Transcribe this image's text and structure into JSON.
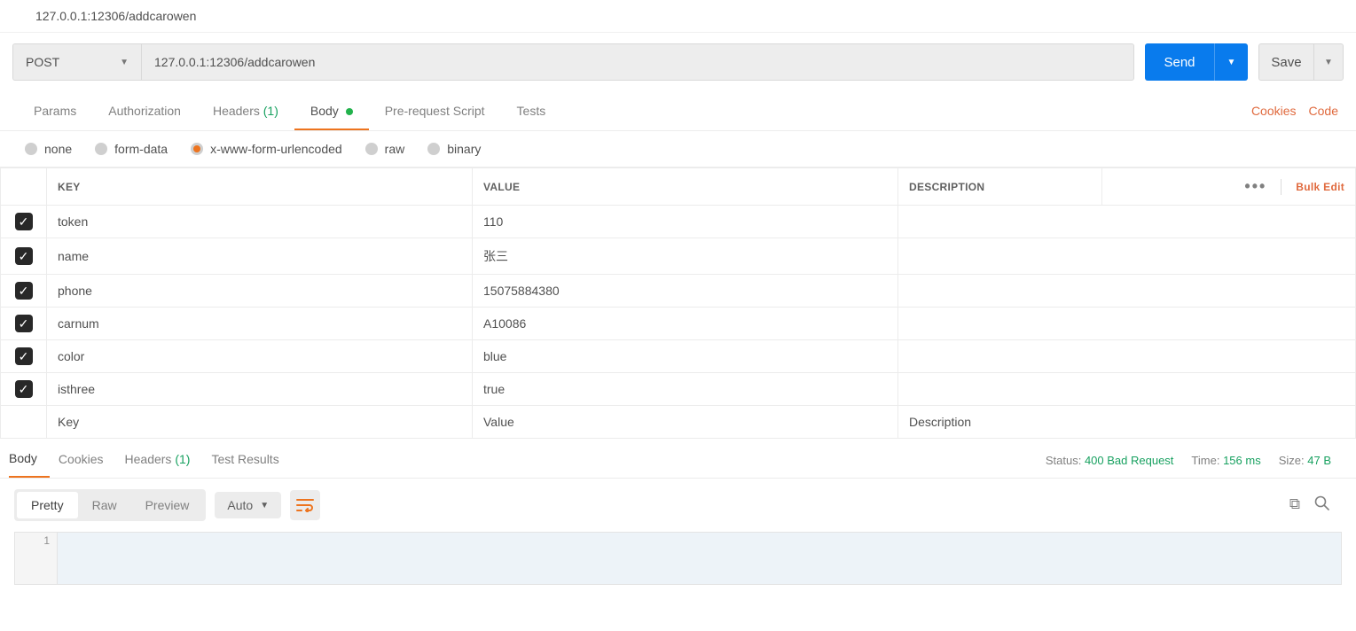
{
  "title": "127.0.0.1:12306/addcarowen",
  "request": {
    "method": "POST",
    "url": "127.0.0.1:12306/addcarowen",
    "send_label": "Send",
    "save_label": "Save"
  },
  "req_tabs": {
    "params": "Params",
    "authorization": "Authorization",
    "headers": "Headers",
    "headers_count": "(1)",
    "body": "Body",
    "prerequest": "Pre-request Script",
    "tests": "Tests",
    "cookies_link": "Cookies",
    "code_link": "Code"
  },
  "body_types": {
    "none": "none",
    "formdata": "form-data",
    "urlencoded": "x-www-form-urlencoded",
    "raw": "raw",
    "binary": "binary"
  },
  "table": {
    "header_key": "KEY",
    "header_value": "VALUE",
    "header_desc": "DESCRIPTION",
    "bulk_edit": "Bulk Edit",
    "key_placeholder": "Key",
    "value_placeholder": "Value",
    "desc_placeholder": "Description",
    "rows": [
      {
        "key": "token",
        "value": "110",
        "desc": ""
      },
      {
        "key": "name",
        "value": "张三",
        "desc": ""
      },
      {
        "key": "phone",
        "value": "15075884380",
        "desc": ""
      },
      {
        "key": "carnum",
        "value": "A10086",
        "desc": ""
      },
      {
        "key": "color",
        "value": "blue",
        "desc": ""
      },
      {
        "key": "isthree",
        "value": "true",
        "desc": ""
      }
    ]
  },
  "response": {
    "tabs": {
      "body": "Body",
      "cookies": "Cookies",
      "headers": "Headers",
      "headers_count": "(1)",
      "tests": "Test Results"
    },
    "status_label": "Status:",
    "status_value": "400 Bad Request",
    "time_label": "Time:",
    "time_value": "156 ms",
    "size_label": "Size:",
    "size_value": "47 B",
    "view": {
      "pretty": "Pretty",
      "raw": "Raw",
      "preview": "Preview",
      "lang": "Auto"
    },
    "line_number": "1"
  }
}
